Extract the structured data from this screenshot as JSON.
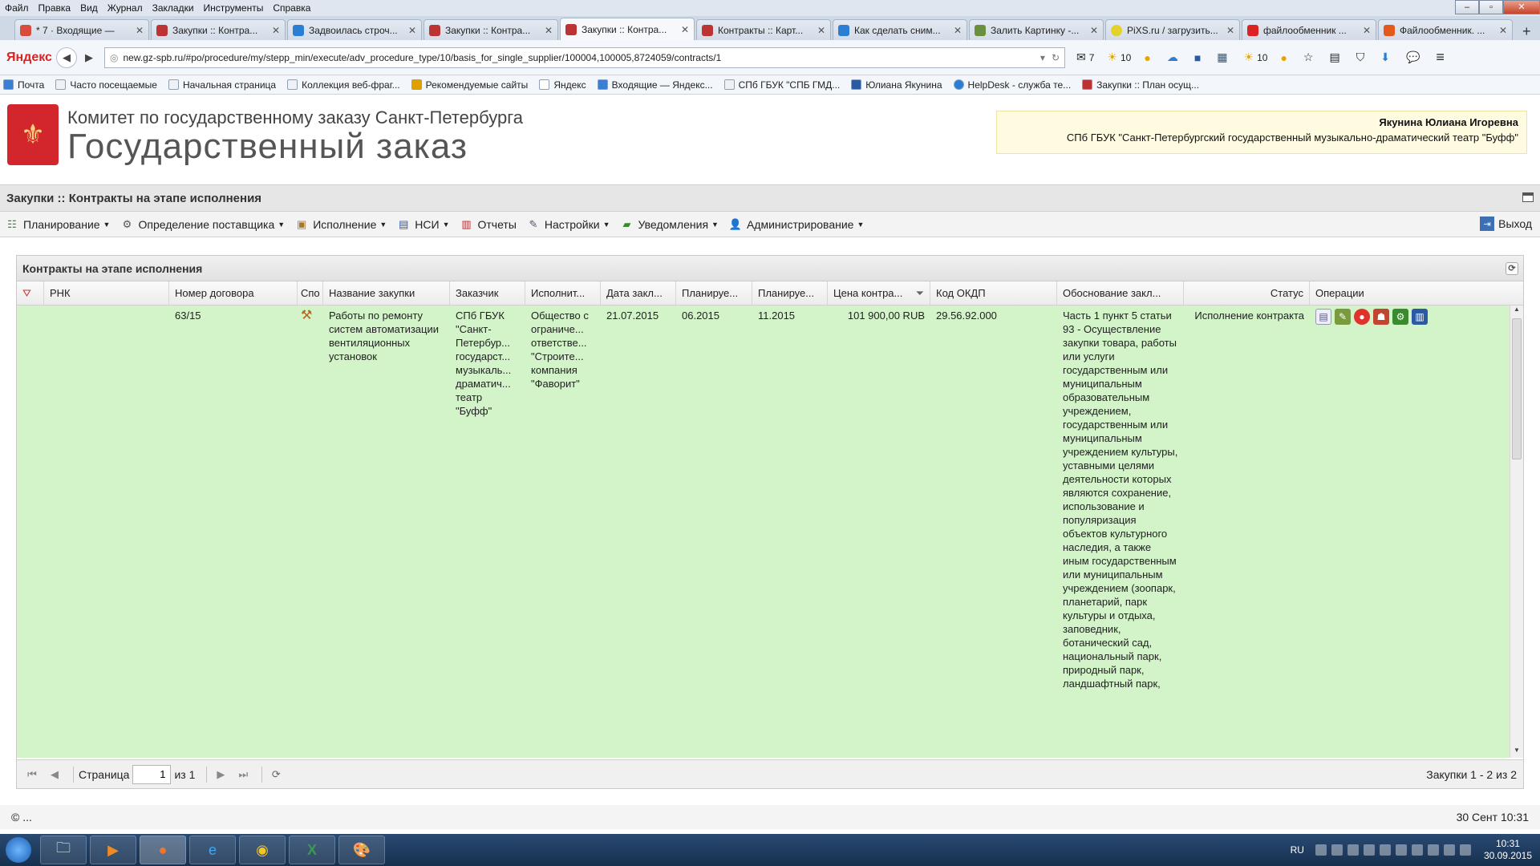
{
  "menubar": [
    "Файл",
    "Правка",
    "Вид",
    "Журнал",
    "Закладки",
    "Инструменты",
    "Справка"
  ],
  "tabs": [
    {
      "label": "* 7 · Входящие —",
      "color": "#d94b3c",
      "active": false
    },
    {
      "label": "Закупки :: Контра...",
      "color": "#b33",
      "active": false
    },
    {
      "label": "Задвоилась строч...",
      "color": "#2b7fd3",
      "active": false
    },
    {
      "label": "Закупки :: Контра...",
      "color": "#b33",
      "active": false
    },
    {
      "label": "Закупки :: Контра...",
      "color": "#b33",
      "active": true
    },
    {
      "label": "Контракты :: Карт...",
      "color": "#b33",
      "active": false
    },
    {
      "label": "Как сделать сним...",
      "color": "#2b7fd3",
      "active": false
    },
    {
      "label": "Залить Картинку -...",
      "color": "#6a8f3e",
      "active": false
    },
    {
      "label": "PiXS.ru / загрузить...",
      "color": "#e2d22a",
      "active": false
    },
    {
      "label": "файлообменник ...",
      "color": "#d22",
      "active": false
    },
    {
      "label": "Файлообменник. ...",
      "color": "#e35a1c",
      "active": false
    }
  ],
  "browser": {
    "brand": "Яндекс",
    "url": "new.gz-spb.ru/#po/procedure/my/stepp_min/execute/adv_procedure_type/10/basis_for_single_supplier/100004,100005,8724059/contracts/1",
    "tools": [
      "7",
      "10",
      "10"
    ]
  },
  "bookmarks": [
    "Почта",
    "Часто посещаемые",
    "Начальная страница",
    "Коллекция веб-фраг...",
    "Рекомендуемые сайты",
    "Яндекс",
    "Входящие — Яндекс...",
    "СПб ГБУК \"СПБ ГМД...",
    "Юлиана Якунина",
    "HelpDesk - служба те...",
    "Закупки :: План осущ..."
  ],
  "header": {
    "org": "Комитет по государственному заказу Санкт-Петербурга",
    "title": "Государственный заказ",
    "user_name": "Якунина Юлиана Игоревна",
    "user_org": "СПб ГБУК \"Санкт-Петербургский государственный музыкально-драматический театр \"Буфф\""
  },
  "app_title": "Закупки :: Контракты на этапе исполнения",
  "toolbar": {
    "items": [
      {
        "label": "Планирование",
        "dropdown": true
      },
      {
        "label": "Определение поставщика",
        "dropdown": true
      },
      {
        "label": "Исполнение",
        "dropdown": true
      },
      {
        "label": "НСИ",
        "dropdown": true
      },
      {
        "label": "Отчеты",
        "dropdown": false
      },
      {
        "label": "Настройки",
        "dropdown": true
      },
      {
        "label": "Уведомления",
        "dropdown": true
      },
      {
        "label": "Администрирование",
        "dropdown": true
      }
    ],
    "logout": "Выход"
  },
  "grid": {
    "title": "Контракты на этапе исполнения",
    "columns": [
      "",
      "РНК",
      "Номер договора",
      "Спо",
      "Название закупки",
      "Заказчик",
      "Исполнит...",
      "Дата закл...",
      "Планируе...",
      "Планируе...",
      "Цена контра...",
      "Код ОКДП",
      "Обоснование закл...",
      "Статус",
      "Операции"
    ],
    "row": {
      "rnk": "",
      "number": "63/15",
      "name": "Работы по ремонту систем автоматизации вентиляционных установок",
      "customer": "СПб ГБУК \"Санкт-Петербур... государст... музыкаль... драматич... театр \"Буфф\"",
      "supplier": "Общество с ограниче... ответстве... \"Строите... компания \"Фаворит\"",
      "date": "21.07.2015",
      "plan_start": "06.2015",
      "plan_end": "11.2015",
      "price": "101 900,00 RUB",
      "okdp": "29.56.92.000",
      "basis": "Часть 1 пункт 5 статьи 93 - Осуществление закупки товара, работы или услуги государственным или муниципальным образовательным учреждением, государственным или муниципальным учреждением культуры, уставными целями деятельности которых являются сохранение, использование и популяризация объектов культурного наследия, а также иным государственным или муниципальным учреждением (зоопарк, планетарий, парк культуры и отдыха, заповедник, ботанический сад, национальный парк, природный парк, ландшафтный парк,",
      "status": "Исполнение контракта"
    },
    "pager": {
      "page_label": "Страница",
      "page_value": "1",
      "of_label": "из 1",
      "summary": "Закупки 1 - 2 из 2"
    }
  },
  "footer": {
    "left": "© ...",
    "right": "30 Сент 10:31"
  },
  "taskbar": {
    "lang": "RU",
    "time": "10:31",
    "date": "30.09.2015"
  }
}
